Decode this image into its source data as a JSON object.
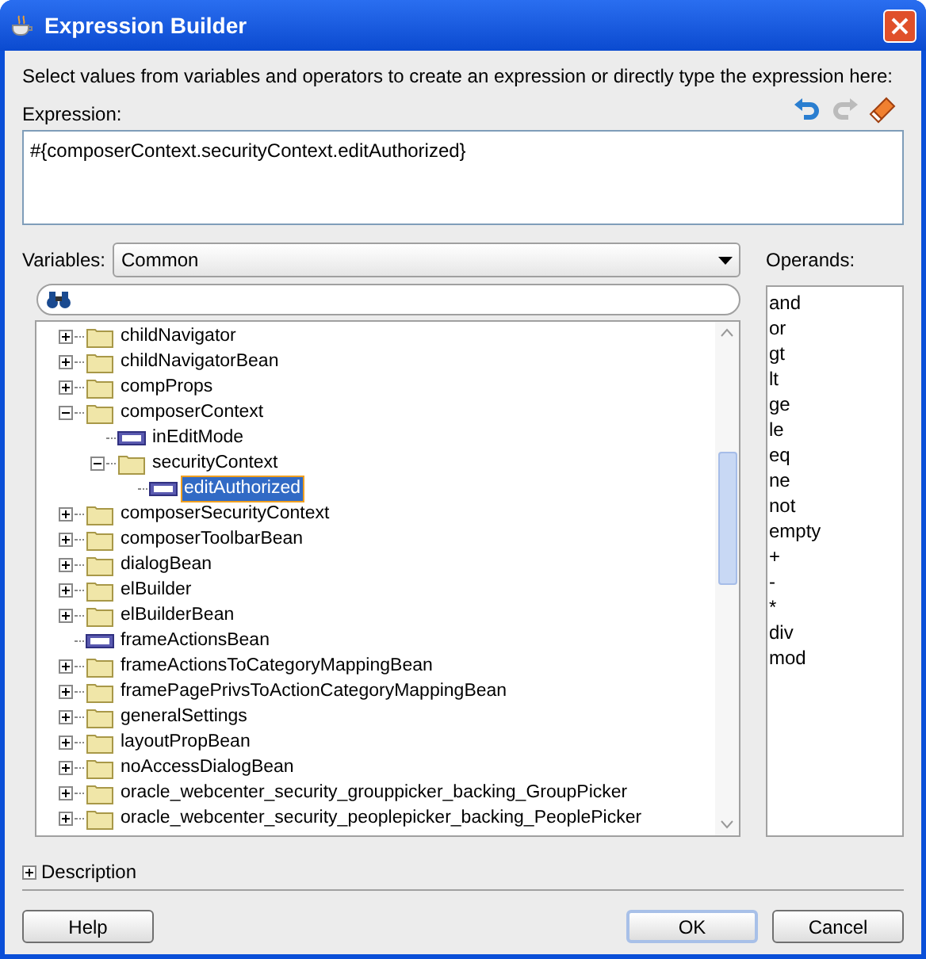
{
  "window": {
    "title": "Expression Builder"
  },
  "instructions": "Select values from variables and operators to create an expression or directly type the expression here:",
  "expression": {
    "label": "Expression:",
    "value": "#{composerContext.securityContext.editAuthorized}"
  },
  "variables": {
    "label": "Variables:",
    "value": "Common"
  },
  "tree": [
    {
      "label": "childNavigator",
      "kind": "folder",
      "expanded": false,
      "selected": false
    },
    {
      "label": "childNavigatorBean",
      "kind": "folder",
      "expanded": false,
      "selected": false
    },
    {
      "label": "compProps",
      "kind": "folder",
      "expanded": false,
      "selected": false
    },
    {
      "label": "composerContext",
      "kind": "folder",
      "expanded": true,
      "selected": false,
      "children": [
        {
          "label": "inEditMode",
          "kind": "variable",
          "selected": false
        },
        {
          "label": "securityContext",
          "kind": "folder",
          "expanded": true,
          "selected": false,
          "children": [
            {
              "label": "editAuthorized",
              "kind": "variable",
              "selected": true
            }
          ]
        }
      ]
    },
    {
      "label": "composerSecurityContext",
      "kind": "folder",
      "expanded": false,
      "selected": false
    },
    {
      "label": "composerToolbarBean",
      "kind": "folder",
      "expanded": false,
      "selected": false
    },
    {
      "label": "dialogBean",
      "kind": "folder",
      "expanded": false,
      "selected": false
    },
    {
      "label": "elBuilder",
      "kind": "folder",
      "expanded": false,
      "selected": false
    },
    {
      "label": "elBuilderBean",
      "kind": "folder",
      "expanded": false,
      "selected": false
    },
    {
      "label": "frameActionsBean",
      "kind": "variable",
      "selected": false
    },
    {
      "label": "frameActionsToCategoryMappingBean",
      "kind": "folder",
      "expanded": false,
      "selected": false
    },
    {
      "label": "framePagePrivsToActionCategoryMappingBean",
      "kind": "folder",
      "expanded": false,
      "selected": false
    },
    {
      "label": "generalSettings",
      "kind": "folder",
      "expanded": false,
      "selected": false
    },
    {
      "label": "layoutPropBean",
      "kind": "folder",
      "expanded": false,
      "selected": false
    },
    {
      "label": "noAccessDialogBean",
      "kind": "folder",
      "expanded": false,
      "selected": false
    },
    {
      "label": "oracle_webcenter_security_grouppicker_backing_GroupPicker",
      "kind": "folder",
      "expanded": false,
      "selected": false
    },
    {
      "label": "oracle_webcenter_security_peoplepicker_backing_PeoplePicker",
      "kind": "folder",
      "expanded": false,
      "selected": false
    }
  ],
  "operands": {
    "label": "Operands:",
    "items": [
      "and",
      "or",
      "gt",
      "lt",
      "ge",
      "le",
      "eq",
      "ne",
      "not",
      "empty",
      "+",
      "-",
      "*",
      "div",
      "mod"
    ]
  },
  "description": {
    "label": "Description",
    "expanded": false
  },
  "buttons": [
    {
      "label": "Help",
      "kind": "help"
    },
    {
      "label": "OK",
      "kind": "default"
    },
    {
      "label": "Cancel",
      "kind": "normal"
    }
  ]
}
